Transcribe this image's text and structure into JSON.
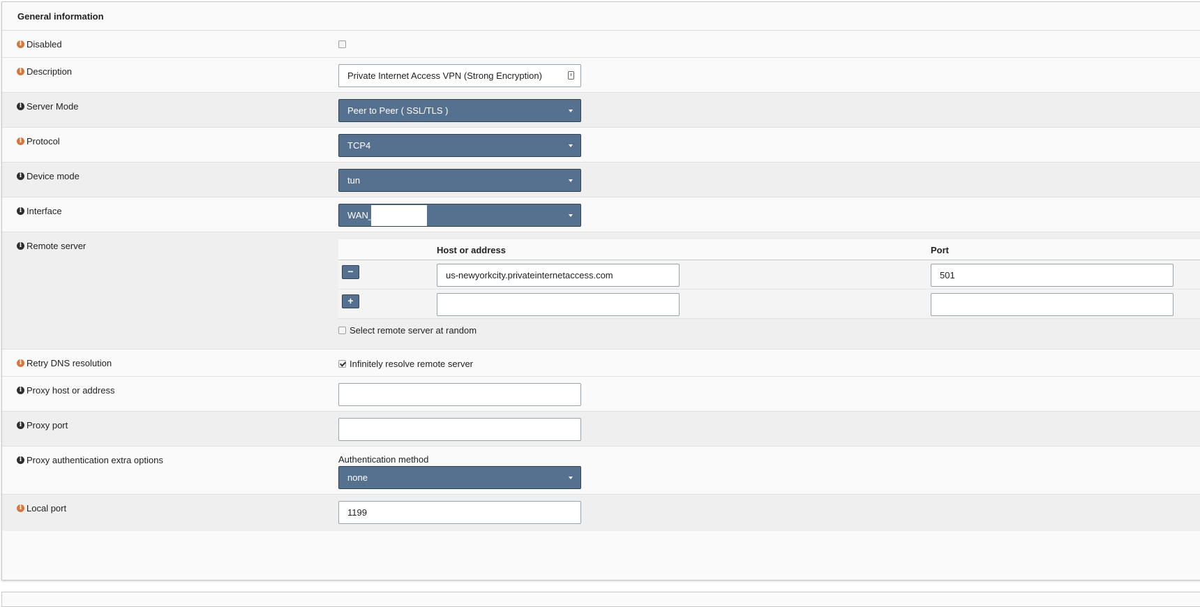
{
  "section": {
    "title": "General information"
  },
  "rows": {
    "disabled": {
      "label": "Disabled",
      "checked": false
    },
    "description": {
      "label": "Description",
      "value": "Private Internet Access VPN (Strong Encryption)"
    },
    "server_mode": {
      "label": "Server Mode",
      "value": "Peer to Peer ( SSL/TLS )"
    },
    "protocol": {
      "label": "Protocol",
      "value": "TCP4"
    },
    "device_mode": {
      "label": "Device mode",
      "value": "tun"
    },
    "interface": {
      "label": "Interface",
      "value": "WAN_"
    },
    "remote_server": {
      "label": "Remote server",
      "col_host": "Host or address",
      "col_port": "Port",
      "entries": [
        {
          "host": "us-newyorkcity.privateinternetaccess.com",
          "port": "501",
          "button": "−"
        },
        {
          "host": "",
          "port": "",
          "button": "+"
        }
      ],
      "random_label": "Select remote server at random",
      "random_checked": false
    },
    "retry_dns": {
      "label": "Retry DNS resolution",
      "option_label": "Infinitely resolve remote server",
      "checked": true
    },
    "proxy_host": {
      "label": "Proxy host or address",
      "value": ""
    },
    "proxy_port": {
      "label": "Proxy port",
      "value": ""
    },
    "proxy_auth": {
      "label": "Proxy authentication extra options",
      "method_label": "Authentication method",
      "method_value": "none"
    },
    "local_port": {
      "label": "Local port",
      "value": "1199"
    }
  },
  "colors": {
    "select_bg": "#56718f",
    "info_orange": "#d2793f",
    "info_dark": "#2e2e2e"
  }
}
